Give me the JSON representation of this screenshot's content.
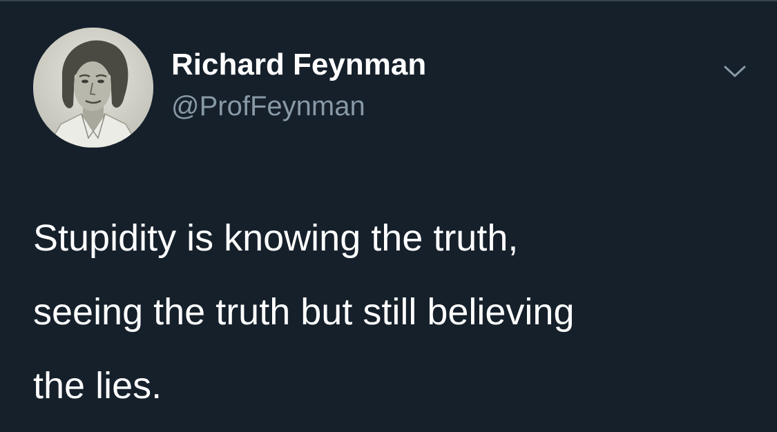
{
  "tweet": {
    "author": {
      "display_name": "Richard Feynman",
      "handle": "@ProfFeynman",
      "avatar_icon": "portrait-avatar"
    },
    "menu_icon": "chevron-down-icon",
    "text_lines": [
      "Stupidity is knowing the truth,",
      "seeing the truth but still believing",
      "the lies."
    ]
  },
  "colors": {
    "background": "#15202b",
    "primary_text": "#ffffff",
    "secondary_text": "#8899a6",
    "divider": "#38444d"
  }
}
